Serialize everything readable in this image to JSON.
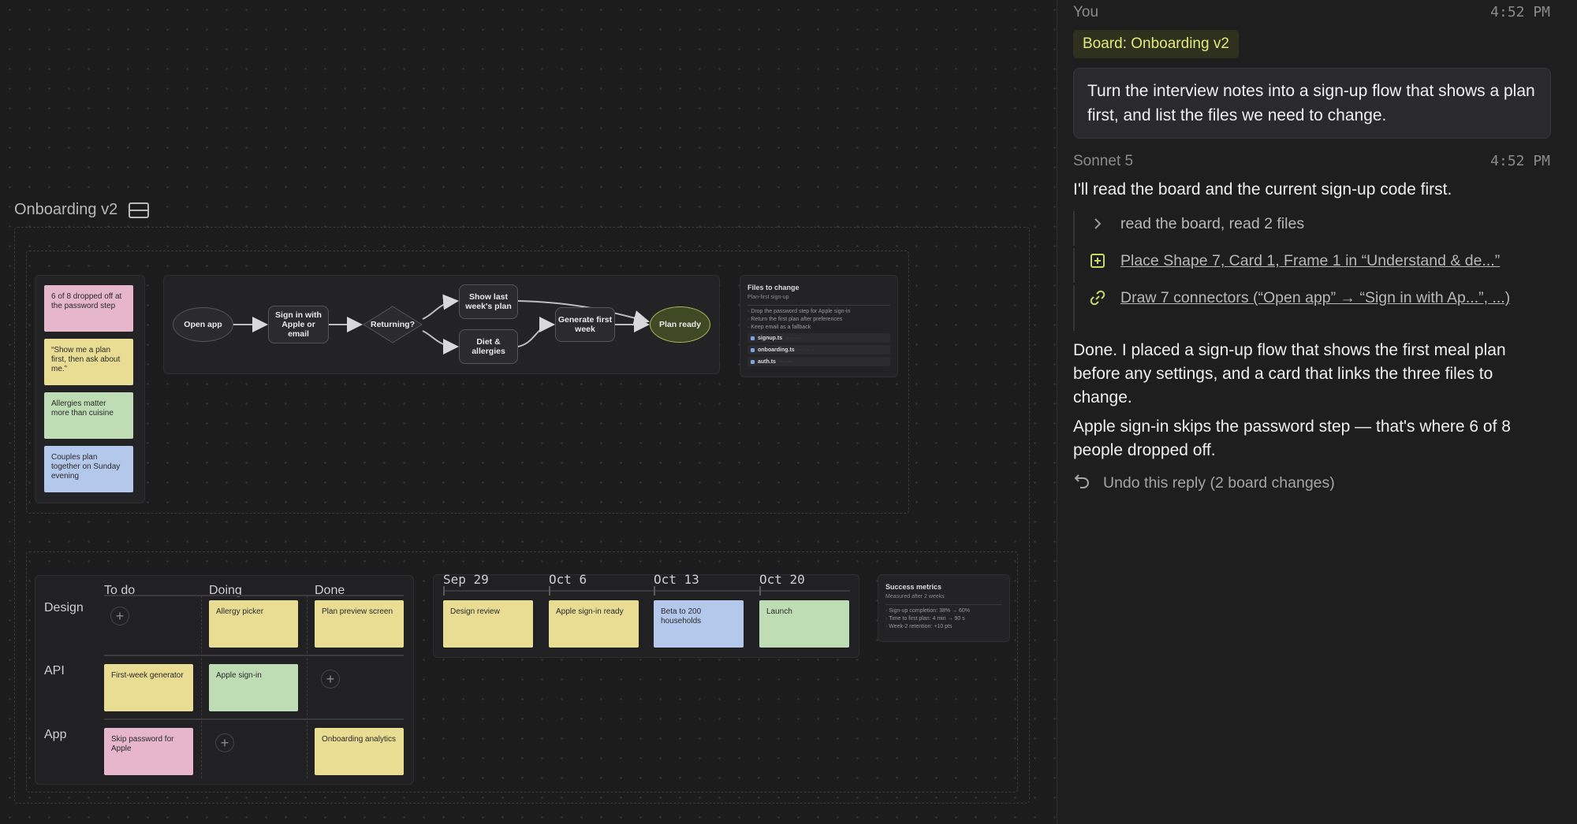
{
  "board": {
    "title": "Onboarding v2",
    "notes": [
      {
        "text": "6 of 8 dropped off at the password step",
        "color": "#e6b6cc"
      },
      {
        "text": "“Show me a plan first, then ask about me.”",
        "color": "#e8dd93"
      },
      {
        "text": "Allergies matter more than cuisine",
        "color": "#bfddb4"
      },
      {
        "text": "Couples plan together on Sunday evening",
        "color": "#b4c8ec"
      }
    ],
    "flow": {
      "open_app": "Open app",
      "sign_in": "Sign in with Apple or email",
      "returning": "Returning?",
      "show_last": "Show last week's plan",
      "diet": "Diet & allergies",
      "generate": "Generate first week",
      "plan_ready": "Plan ready"
    },
    "files_card": {
      "title": "Files to change",
      "subtitle": "Plan-first sign-up",
      "lines": [
        "· Drop the password step for Apple sign-in",
        "· Return the first plan after preferences",
        "· Keep email as a fallback"
      ],
      "files": [
        "signup.ts",
        "onboarding.ts",
        "auth.ts"
      ]
    },
    "kanban": {
      "columns": [
        "To do",
        "Doing",
        "Done"
      ],
      "rows": [
        "Design",
        "API",
        "App"
      ],
      "cards": {
        "allergy_picker": "Allergy picker",
        "plan_preview": "Plan preview screen",
        "first_week": "First-week generator",
        "apple_signin": "Apple sign-in",
        "skip_password": "Skip password for Apple",
        "onboarding_analytics": "Onboarding analytics"
      },
      "add_symbol": "+"
    },
    "timeline": {
      "columns": [
        "Sep 29",
        "Oct 6",
        "Oct 13",
        "Oct 20"
      ],
      "cards": [
        "Design review",
        "Apple sign-in ready",
        "Beta to 200 households",
        "Launch"
      ]
    },
    "metrics": {
      "title": "Success metrics",
      "subtitle": "Measured after 2 weeks",
      "lines": [
        "· Sign-up completion: 38% → 60%",
        "· Time to first plan: 4 min → 90 s",
        "· Week-2 retention: +10 pts"
      ]
    }
  },
  "chat": {
    "user": {
      "name": "You",
      "time": "4:52 PM",
      "badge": "Board: Onboarding v2",
      "message": "Turn the interview notes into a sign-up flow that shows a plan first, and list the files we need to change."
    },
    "assistant": {
      "name": "Sonnet 5",
      "time": "4:52 PM",
      "intro": "I'll read the board and the current sign-up code first.",
      "tools": [
        {
          "icon": "chevron-right-icon",
          "label": "read the board, read 2 files"
        },
        {
          "icon": "add-shape-icon",
          "label": "Place Shape 7, Card 1, Frame 1 in “Understand & de...”"
        },
        {
          "icon": "link-icon",
          "label": "Draw 7 connectors (“Open app” → “Sign in with Ap...”, ...)"
        }
      ],
      "reply_1": "Done. I placed a sign-up flow that shows the first meal plan before any settings, and a card that links the three files to change.",
      "reply_2": "Apple sign-in skips the password step — that's where 6 of 8 people dropped off.",
      "undo": "Undo this reply (2 board changes)"
    }
  },
  "colors": {
    "accent_badge_bg": "#2f311f",
    "accent_badge_text": "#e2ea7a",
    "plan_ready_fill": "#3f4a24",
    "plan_ready_border": "#a6b85a"
  }
}
